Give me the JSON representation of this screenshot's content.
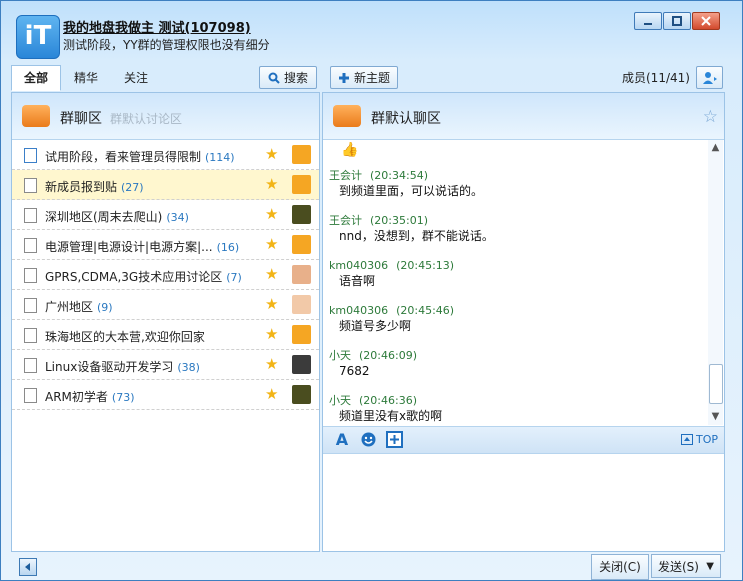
{
  "window": {
    "title": "我的地盘我做主 测试(107098)",
    "subtitle": "测试阶段，YY群的管理权限也没有细分",
    "logo_text": "iT"
  },
  "tabs": [
    {
      "label": "全部",
      "active": true
    },
    {
      "label": "精华",
      "active": false
    },
    {
      "label": "关注",
      "active": false
    }
  ],
  "search_label": "搜索",
  "new_topic_label": "新主题",
  "members_label": "成员(11/41)",
  "left_panel": {
    "title": "群聊区",
    "subtitle": "群默认讨论区"
  },
  "topics": [
    {
      "name": "试用阶段，看来管理员得限制",
      "count": "(114)",
      "hot": true,
      "avatar": "#f5a623"
    },
    {
      "name": "新成员报到贴",
      "count": "(27)",
      "hot": false,
      "avatar": "#f5a623",
      "selected": true
    },
    {
      "name": "深圳地区(周末去爬山)",
      "count": "(34)",
      "hot": false,
      "avatar": "#4a4d1f"
    },
    {
      "name": "电源管理|电源设计|电源方案|...",
      "count": "(16)",
      "hot": false,
      "avatar": "#f5a623"
    },
    {
      "name": "GPRS,CDMA,3G技术应用讨论区",
      "count": "(7)",
      "hot": false,
      "avatar": "#e8b08a"
    },
    {
      "name": "广州地区",
      "count": "(9)",
      "hot": false,
      "avatar": "#f2c9a8"
    },
    {
      "name": "珠海地区的大本营,欢迎你回家",
      "count": "",
      "hot": false,
      "avatar": "#f5a623"
    },
    {
      "name": "Linux设备驱动开发学习",
      "count": "(38)",
      "hot": false,
      "avatar": "#3b3b3b"
    },
    {
      "name": "ARM初学者",
      "count": "(73)",
      "hot": false,
      "avatar": "#4a4d1f"
    }
  ],
  "right_panel": {
    "title": "群默认聊区"
  },
  "messages": [
    {
      "user": "王会计",
      "time": "(20:34:54)",
      "text": "到频道里面，可以说话的。"
    },
    {
      "user": "王会计",
      "time": "(20:35:01)",
      "text": "nnd，没想到，群不能说话。"
    },
    {
      "user": "km040306",
      "time": "(20:45:13)",
      "text": "语音啊"
    },
    {
      "user": "km040306",
      "time": "(20:45:46)",
      "text": "频道号多少啊"
    },
    {
      "user": "小天",
      "time": "(20:46:09)",
      "text": "7682"
    },
    {
      "user": "小天",
      "time": "(20:46:36)",
      "text": "频道里没有x歌的啊"
    }
  ],
  "toolbar": {
    "font_icon": "A",
    "top_label": "TOP"
  },
  "bottom": {
    "close_label": "关闭(C)",
    "send_label": "发送(S)"
  }
}
